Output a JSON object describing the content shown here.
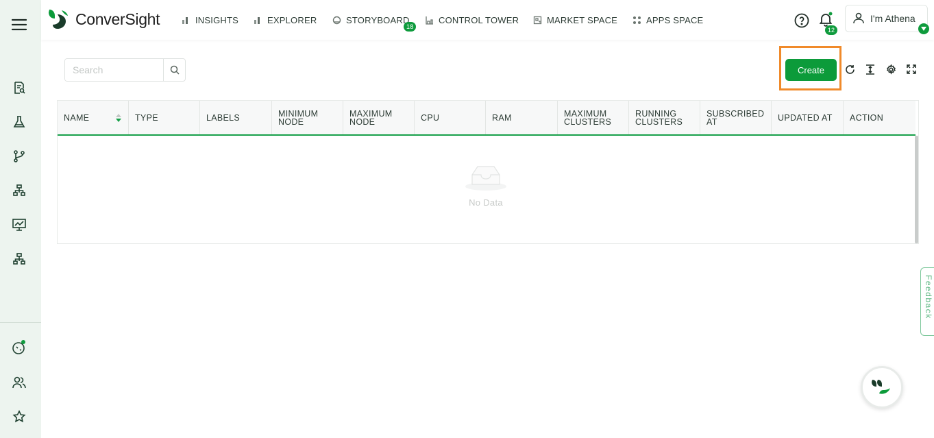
{
  "app": {
    "brand": "ConverSight",
    "accent": "#0c9b3a",
    "highlight": "#f08a2a"
  },
  "nav": {
    "items": [
      {
        "label": "INSIGHTS",
        "icon": "bar-chart-icon"
      },
      {
        "label": "EXPLORER",
        "icon": "bar-chart-icon"
      },
      {
        "label": "STORYBOARD",
        "icon": "storyboard-icon",
        "badge": "18"
      },
      {
        "label": "CONTROL TOWER",
        "icon": "tower-icon"
      },
      {
        "label": "MARKET SPACE",
        "icon": "market-icon"
      },
      {
        "label": "APPS SPACE",
        "icon": "apps-grid-icon"
      }
    ],
    "notifications_count": "12",
    "user_label": "I'm Athena"
  },
  "toolbar": {
    "search_placeholder": "Search",
    "create_label": "Create"
  },
  "table": {
    "columns": [
      "NAME",
      "TYPE",
      "LABELS",
      "MINIMUM NODE",
      "MAXIMUM NODE",
      "CPU",
      "RAM",
      "MAXIMUM CLUSTERS",
      "RUNNING CLUSTERS",
      "SUBSCRIBED AT",
      "UPDATED AT",
      "ACTION"
    ],
    "rows": [],
    "empty_text": "No Data"
  },
  "feedback_label": "Feedback"
}
